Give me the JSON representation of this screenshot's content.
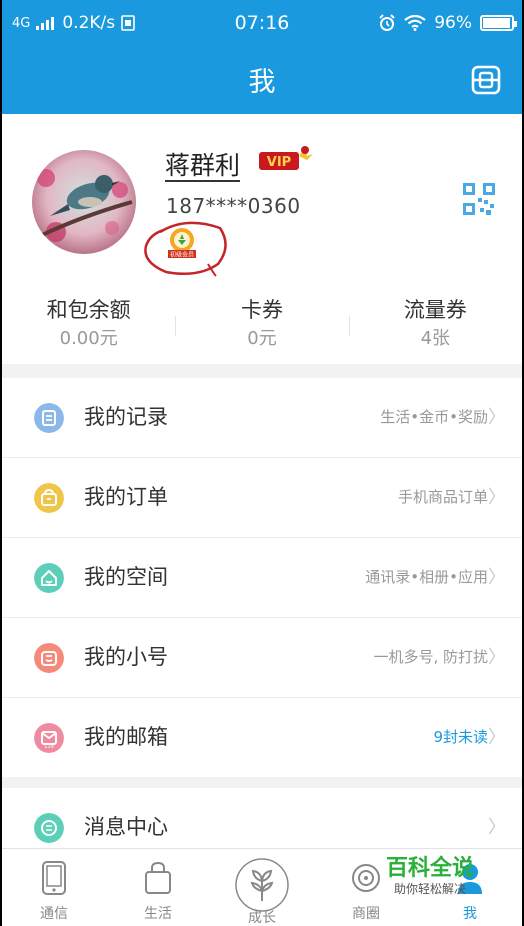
{
  "status_bar": {
    "network": "4G",
    "speed": "0.2K/s",
    "time": "07:16",
    "battery": "96%",
    "battery_fraction": 0.96
  },
  "header": {
    "title": "我"
  },
  "profile": {
    "name": "蒋群利",
    "phone": "187****0360",
    "vip_label": "VIP",
    "badge_text": "初级会员"
  },
  "stats": [
    {
      "label": "和包余额",
      "value": "0.00元"
    },
    {
      "label": "卡券",
      "value": "0元"
    },
    {
      "label": "流量券",
      "value": "4张"
    }
  ],
  "menu": [
    {
      "label": "我的记录",
      "sub": "生活•金币•奖励",
      "icon": "record-icon",
      "color": "#8ab8e8"
    },
    {
      "label": "我的订单",
      "sub": "手机商品订单",
      "icon": "order-icon",
      "color": "#f0c64a"
    },
    {
      "label": "我的空间",
      "sub": "通讯录•相册•应用",
      "icon": "space-icon",
      "color": "#5ccfb9"
    },
    {
      "label": "我的小号",
      "sub": "一机多号, 防打扰",
      "icon": "subnumber-icon",
      "color": "#f58a7a"
    },
    {
      "label": "我的邮箱",
      "sub": "9封未读",
      "icon": "mailbox-icon",
      "color": "#f08aa0",
      "sub_color": "#1a99de"
    }
  ],
  "menu2": [
    {
      "label": "消息中心",
      "icon": "message-icon",
      "color": "#5ccfb9"
    }
  ],
  "tabs": [
    {
      "label": "通信",
      "icon": "phone-icon"
    },
    {
      "label": "生活",
      "icon": "bag-icon"
    },
    {
      "label": "成长",
      "icon": "growth-icon"
    },
    {
      "label": "商圈",
      "icon": "business-icon"
    },
    {
      "label": "我",
      "icon": "me-icon",
      "active": true
    }
  ],
  "colors": {
    "brand_blue": "#1a99de",
    "annotation_red": "#c4252a"
  },
  "watermark": {
    "title": "百科全说",
    "subtitle": "助你轻松解决"
  }
}
